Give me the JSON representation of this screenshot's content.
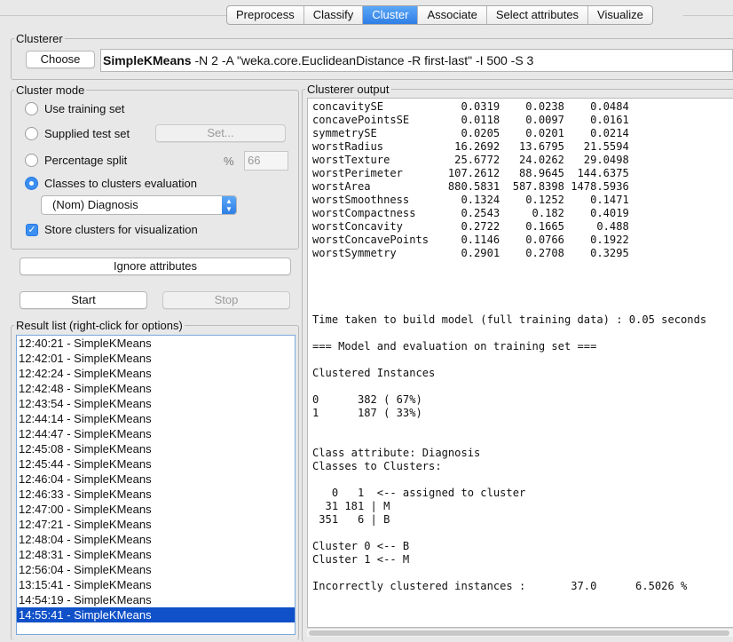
{
  "tabs": [
    "Preprocess",
    "Classify",
    "Cluster",
    "Associate",
    "Select attributes",
    "Visualize"
  ],
  "active_tab": "Cluster",
  "clusterer": {
    "legend": "Clusterer",
    "choose_label": "Choose",
    "scheme_name": "SimpleKMeans",
    "scheme_options": "-N 2 -A \"weka.core.EuclideanDistance -R first-last\" -I 500 -S 3"
  },
  "cluster_mode": {
    "legend": "Cluster mode",
    "use_training_set": "Use training set",
    "supplied_test_set": "Supplied test set",
    "set_button": "Set...",
    "percentage_split": "Percentage split",
    "percent_symbol": "%",
    "percent_value": "66",
    "classes_to_clusters": "Classes to clusters evaluation",
    "class_select": "(Nom) Diagnosis",
    "store_clusters": "Store clusters for visualization",
    "selected": "classes_to_clusters"
  },
  "ignore_attributes_label": "Ignore attributes",
  "start_label": "Start",
  "stop_label": "Stop",
  "result_list": {
    "legend": "Result list (right-click for options)",
    "items": [
      "12:40:21 - SimpleKMeans",
      "12:42:01 - SimpleKMeans",
      "12:42:24 - SimpleKMeans",
      "12:42:48 - SimpleKMeans",
      "12:43:54 - SimpleKMeans",
      "12:44:14 - SimpleKMeans",
      "12:44:47 - SimpleKMeans",
      "12:45:08 - SimpleKMeans",
      "12:45:44 - SimpleKMeans",
      "12:46:04 - SimpleKMeans",
      "12:46:33 - SimpleKMeans",
      "12:47:00 - SimpleKMeans",
      "12:47:21 - SimpleKMeans",
      "12:48:04 - SimpleKMeans",
      "12:48:31 - SimpleKMeans",
      "12:56:04 - SimpleKMeans",
      "13:15:41 - SimpleKMeans",
      "14:54:19 - SimpleKMeans",
      "14:55:41 - SimpleKMeans"
    ],
    "selected_index": 18
  },
  "clusterer_output": {
    "legend": "Clusterer output",
    "lines": [
      "concavitySE            0.0319    0.0238    0.0484",
      "concavePointsSE        0.0118    0.0097    0.0161",
      "symmetrySE             0.0205    0.0201    0.0214",
      "worstRadius           16.2692   13.6795   21.5594",
      "worstTexture          25.6772   24.0262   29.0498",
      "worstPerimeter       107.2612   88.9645  144.6375",
      "worstArea            880.5831  587.8398 1478.5936",
      "worstSmoothness        0.1324    0.1252    0.1471",
      "worstCompactness       0.2543     0.182    0.4019",
      "worstConcavity         0.2722    0.1665     0.488",
      "worstConcavePoints     0.1146    0.0766    0.1922",
      "worstSymmetry          0.2901    0.2708    0.3295",
      "",
      "",
      "",
      "",
      "Time taken to build model (full training data) : 0.05 seconds",
      "",
      "=== Model and evaluation on training set ===",
      "",
      "Clustered Instances",
      "",
      "0      382 ( 67%)",
      "1      187 ( 33%)",
      "",
      "",
      "Class attribute: Diagnosis",
      "Classes to Clusters:",
      "",
      "   0   1  <-- assigned to cluster",
      "  31 181 | M",
      " 351   6 | B",
      "",
      "Cluster 0 <-- B",
      "Cluster 1 <-- M",
      "",
      "Incorrectly clustered instances :       37.0      6.5026 %"
    ]
  }
}
